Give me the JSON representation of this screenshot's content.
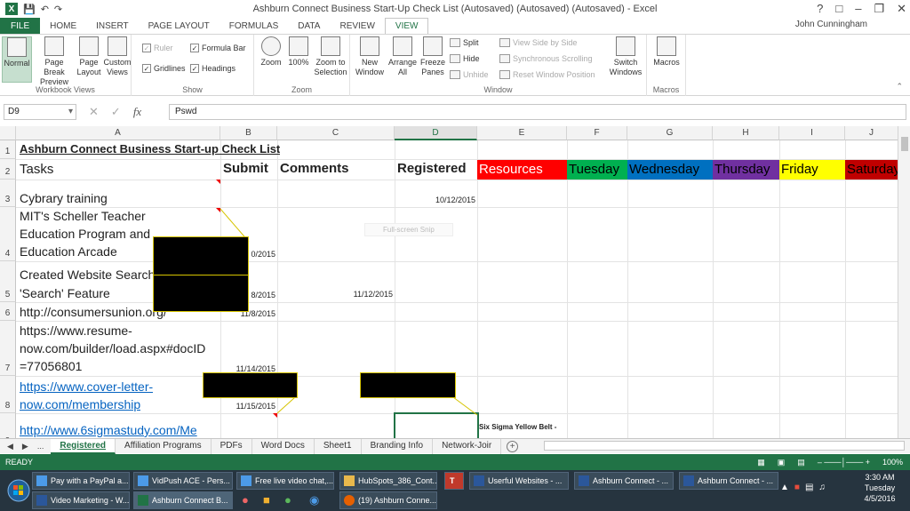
{
  "window": {
    "title": "Ashburn Connect  Business Start-Up Check List (Autosaved) (Autosaved) (Autosaved) - Excel",
    "user": "John Cunningham",
    "help": "?"
  },
  "ribbon_tabs": [
    "FILE",
    "HOME",
    "INSERT",
    "PAGE LAYOUT",
    "FORMULAS",
    "DATA",
    "REVIEW",
    "VIEW"
  ],
  "ribbon": {
    "workbook_views": {
      "label": "Workbook Views",
      "normal": "Normal",
      "page_break": "Page Break Preview",
      "page_layout": "Page Layout",
      "custom_views": "Custom Views"
    },
    "show": {
      "label": "Show",
      "ruler": "Ruler",
      "formula_bar": "Formula Bar",
      "gridlines": "Gridlines",
      "headings": "Headings"
    },
    "zoom": {
      "label": "Zoom",
      "zoom": "Zoom",
      "hundred": "100%",
      "zoom_selection": "Zoom to Selection"
    },
    "window": {
      "label": "Window",
      "new_window": "New Window",
      "arrange_all": "Arrange All",
      "freeze_panes": "Freeze Panes",
      "split": "Split",
      "hide": "Hide",
      "unhide": "Unhide",
      "side_by_side": "View Side by Side",
      "sync_scroll": "Synchronous Scrolling",
      "reset_pos": "Reset Window Position",
      "switch_windows": "Switch Windows"
    },
    "macros": {
      "label": "Macros",
      "macros": "Macros"
    }
  },
  "formula_bar": {
    "name_box": "D9",
    "fx": "fx",
    "value": "Pswd"
  },
  "columns": [
    "A",
    "B",
    "C",
    "D",
    "E",
    "F",
    "G",
    "H",
    "I",
    "J"
  ],
  "rows": [
    "1",
    "2",
    "3",
    "4",
    "5",
    "6",
    "7",
    "8",
    "9"
  ],
  "cells": {
    "a1": "Ashburn Connect  Business Start-up Check List",
    "a2": "Tasks",
    "b2": "Submit",
    "c2": "Comments",
    "d2": "Registered",
    "e2": "Resources",
    "f2": "Tuesday",
    "g2": "Wednesday",
    "h2": "Thursday",
    "i2": "Friday",
    "j2": "Saturday",
    "a3": "Cybrary training",
    "d3": "10/12/2015",
    "a4_1": "MIT's Scheller Teacher",
    "a4_2": "Education Program and",
    "a4_3": "Education Arcade",
    "b4": "0/2015",
    "a5_1": "Created Website Search",
    "a5_2": "'Search' Feature",
    "b5": "8/2015",
    "c5": "11/12/2015",
    "a6": "http://consumersunion.org/",
    "b6": "11/8/2015",
    "a7_1": "https://www.resume-",
    "a7_2": "now.com/builder/load.aspx#docID",
    "a7_3": "=77056801",
    "b7": "11/14/2015",
    "a8_1": "https://www.cover-letter-",
    "a8_2": "now.com/membership",
    "b8": "11/15/2015",
    "a9": "http://www.6sigmastudy.com/Me",
    "e9_note": "Six Sigma Yellow Belt -"
  },
  "overlay_text": "Full-screen Snip",
  "sheet_tabs": [
    "Registered",
    "Affiliation Programs",
    "PDFs",
    "Word Docs",
    "Sheet1",
    "Branding Info",
    "Network-Joir"
  ],
  "sheet_nav": "...",
  "status": {
    "ready": "READY",
    "zoom": "100%"
  },
  "colors": {
    "resources": "#ff0000",
    "tuesday": "#00b050",
    "wednesday": "#0070c0",
    "thursday": "#7030a0",
    "friday": "#ffff00",
    "saturday": "#c00000",
    "excel_green": "#217346"
  },
  "taskbar": {
    "row1": [
      "Pay with a PayPal a...",
      "VidPush ACE - Pers...",
      "Free live video chat,...",
      "HubSpots_386_Cont...",
      "Userful Websites - ...",
      "Ashburn Connect - ...",
      "Ashburn Connect - ..."
    ],
    "row2": [
      "Video Marketing - W...",
      "Ashburn Connect  B...",
      "(19) Ashburn Conne..."
    ],
    "time": "3:30 AM",
    "day": "Tuesday",
    "date": "4/5/2016"
  }
}
